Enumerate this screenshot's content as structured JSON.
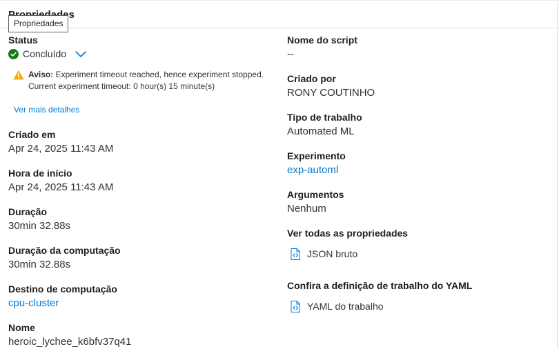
{
  "header": {
    "title": "Propriedades",
    "tooltip": "Propriedades"
  },
  "left": {
    "status": {
      "label": "Status",
      "value": "Concluído",
      "color": "#107c10"
    },
    "warning": {
      "prefix": "Aviso:",
      "line1": "Experiment timeout reached, hence experiment stopped.",
      "line2": "Current experiment timeout: 0 hour(s) 15 minute(s)",
      "color": "#f7a900"
    },
    "more_details": "Ver mais detalhes",
    "created_on": {
      "label": "Criado em",
      "value": "Apr 24, 2025 11:43 AM"
    },
    "start_time": {
      "label": "Hora de início",
      "value": "Apr 24, 2025 11:43 AM"
    },
    "duration": {
      "label": "Duração",
      "value": "30min 32.88s"
    },
    "compute_duration": {
      "label": "Duração da computação",
      "value": "30min 32.88s"
    },
    "compute_target": {
      "label": "Destino de computação",
      "value": "cpu-cluster"
    },
    "name": {
      "label": "Nome",
      "value": "heroic_lychee_k6bfv37q41"
    }
  },
  "right": {
    "script_name": {
      "label": "Nome do script",
      "value": "--"
    },
    "created_by": {
      "label": "Criado por",
      "value": "RONY COUTINHO"
    },
    "job_type": {
      "label": "Tipo de trabalho",
      "value": "Automated ML"
    },
    "experiment": {
      "label": "Experimento",
      "value": "exp-automl"
    },
    "arguments": {
      "label": "Argumentos",
      "value": "Nenhum"
    },
    "all_properties": {
      "label": "Ver todas as propriedades",
      "link": "JSON bruto"
    },
    "yaml": {
      "label": "Confira a definição de trabalho do YAML",
      "link": "YAML do trabalho"
    }
  },
  "colors": {
    "link": "#0078d4",
    "text": "#323130"
  }
}
